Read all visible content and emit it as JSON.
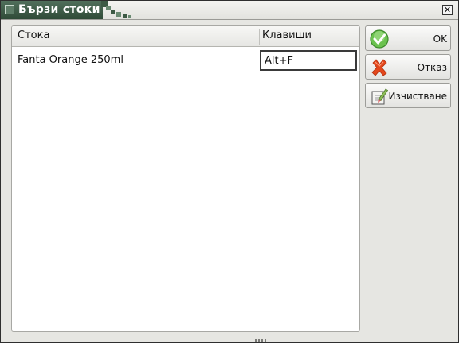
{
  "window": {
    "title": "Бързи стоки",
    "close_glyph": "✕"
  },
  "grid": {
    "columns": [
      "Стока",
      "Клавиши"
    ],
    "rows": [
      {
        "product": "Fanta Orange 250ml",
        "keys": "Alt+F"
      }
    ]
  },
  "buttons": {
    "ok": {
      "label": "OK",
      "icon": "check-icon",
      "color": "#49a83a"
    },
    "cancel": {
      "label": "Отказ",
      "icon": "cross-icon",
      "color": "#e3471c"
    },
    "clear": {
      "label": "Изчистване",
      "icon": "clear-icon"
    }
  },
  "colors": {
    "title_bar": "#2f4a37",
    "window_bg": "#e6e6e2"
  }
}
